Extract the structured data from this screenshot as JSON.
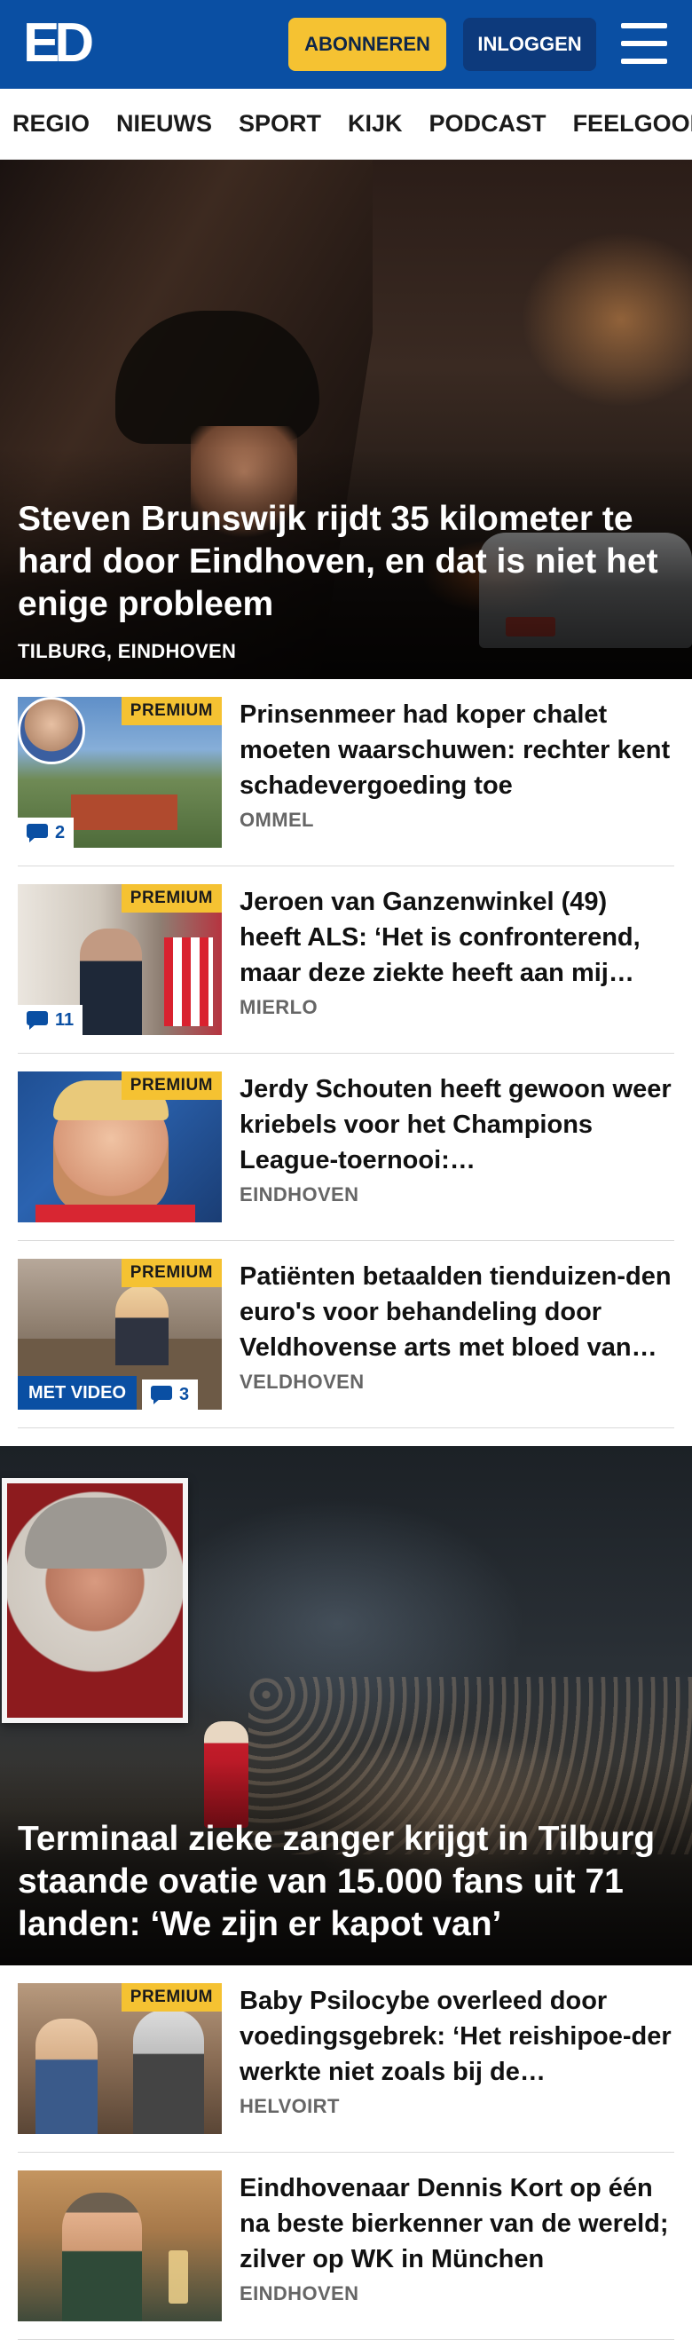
{
  "header": {
    "logo": "ED",
    "subscribe_label": "ABONNEREN",
    "login_label": "INLOGGEN",
    "brand_color": "#0a4fa3",
    "accent_color": "#f5c232"
  },
  "nav": {
    "items": [
      "REGIO",
      "NIEUWS",
      "SPORT",
      "KIJK",
      "PODCAST",
      "FEELGOOD"
    ]
  },
  "hero": {
    "title": "Steven Brunswijk rijdt 35 kilometer te hard door Eindhoven, en dat is niet het enige probleem",
    "location": "TILBURG, EINDHOVEN"
  },
  "articles": [
    {
      "title": "Prinsenmeer had koper chalet moeten waarschuwen: rechter kent schadevergoeding toe",
      "location": "OMMEL",
      "premium": "PREMIUM",
      "comments": "2"
    },
    {
      "title": "Jeroen van Ganzenwinkel (49) heeft ALS: ‘Het is confronterend, maar deze ziekte heeft aan mij…",
      "location": "MIERLO",
      "premium": "PREMIUM",
      "comments": "11"
    },
    {
      "title": "Jerdy Schouten heeft gewoon weer kriebels voor het Champions League-toernooi:…",
      "location": "EINDHOVEN",
      "premium": "PREMIUM"
    },
    {
      "title": "Patiënten betaalden tienduizen-den euro's voor behandeling door Veldhovense arts met bloed van…",
      "location": "VELDHOVEN",
      "premium": "PREMIUM",
      "video": "MET VIDEO",
      "comments": "3"
    }
  ],
  "feature": {
    "title": "Terminaal zieke zanger krijgt in Tilburg staande ovatie van 15.000 fans uit 71 landen: ‘We zijn er kapot van’"
  },
  "articles_2": [
    {
      "title": "Baby Psilocybe overleed door voedingsgebrek: ‘Het reishipoe-der werkte niet zoals bij de…",
      "location": "HELVOIRT",
      "premium": "PREMIUM"
    },
    {
      "title": "Eindhovenaar Dennis Kort op één na beste bierkenner van de wereld; zilver op WK in München",
      "location": "EINDHOVEN"
    }
  ]
}
